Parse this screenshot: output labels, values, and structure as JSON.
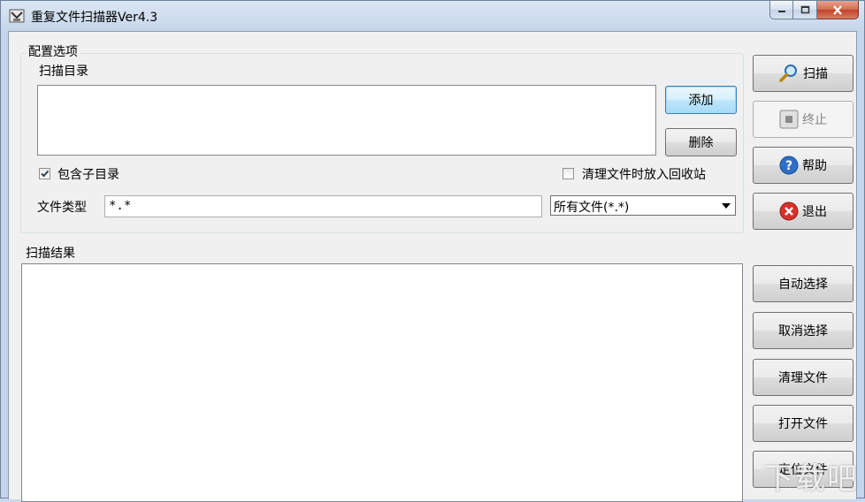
{
  "window": {
    "title": "重复文件扫描器Ver4.3"
  },
  "config": {
    "group_label": "配置选项",
    "scan_dir_label": "扫描目录",
    "add_label": "添加",
    "delete_label": "删除",
    "include_subdirs_label": "包含子目录",
    "include_subdirs_checked": true,
    "recycle_label": "清理文件时放入回收站",
    "recycle_checked": false,
    "file_type_label": "文件类型",
    "file_type_value": "*.*",
    "file_type_select": "所有文件(*.*)"
  },
  "actions": {
    "scan_label": "扫描",
    "stop_label": "终止",
    "help_label": "帮助",
    "exit_label": "退出"
  },
  "results": {
    "label": "扫描结果",
    "auto_select_label": "自动选择",
    "cancel_select_label": "取消选择",
    "clean_label": "清理文件",
    "open_label": "打开文件",
    "locate_label": "定位文件"
  },
  "watermark": "下载吧"
}
